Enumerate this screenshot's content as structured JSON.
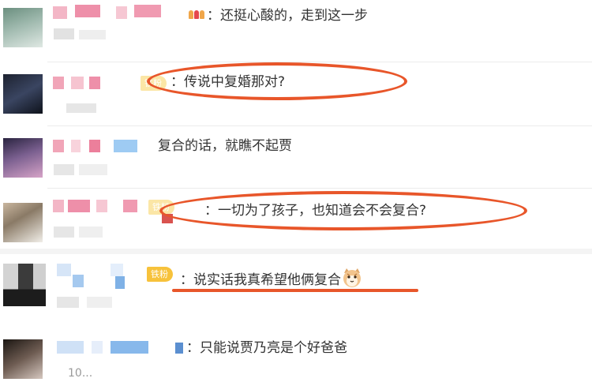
{
  "accent_color": "#e8562a",
  "badge_color": "#f7c23b",
  "comments": [
    {
      "text": "：还挺心酸的，走到这一步",
      "badge": null,
      "icon": "crown-icon"
    },
    {
      "text": "：传说中复婚那对?",
      "badge": "铁粉",
      "icon": null,
      "highlight": "circle"
    },
    {
      "text": "复合的话，就瞧不起贾",
      "badge": null,
      "icon": null
    },
    {
      "text": "：一切为了孩子，也知道会不会复合?",
      "badge": "铁粉",
      "icon": null,
      "highlight": "circle"
    },
    {
      "text": "：说实话我真希望他俩复合",
      "badge": "铁粉",
      "icon": "cat-emoji-icon",
      "highlight": "underline"
    },
    {
      "text": "：只能说贾乃亮是个好爸爸",
      "badge": null,
      "icon": null
    },
    {
      "partial_text": "10..."
    }
  ]
}
